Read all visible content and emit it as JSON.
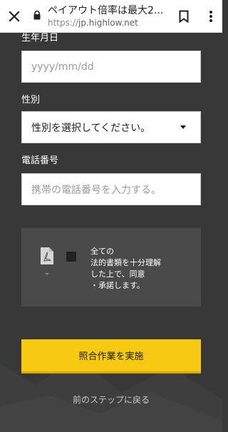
{
  "browser": {
    "title": "ペイアウト倍率は最大2...",
    "url_scheme": "https://",
    "url_host": "jp.highlow.net"
  },
  "form": {
    "dob_label": "生年月日",
    "dob_placeholder": "yyyy/mm/dd",
    "gender_label": "性別",
    "gender_value": "性別を選択してください。",
    "phone_label": "電話番号",
    "phone_placeholder": "携帯の電話番号を入力する。"
  },
  "consent": {
    "text": "全ての\n法的書類を十分理解\nした上で、同意\n・承諾します。",
    "checked": false
  },
  "actions": {
    "submit_label": "照合作業を実施",
    "back_label": "前のステップに戻る"
  },
  "colors": {
    "background": "#383838",
    "accent": "#f7c913"
  }
}
